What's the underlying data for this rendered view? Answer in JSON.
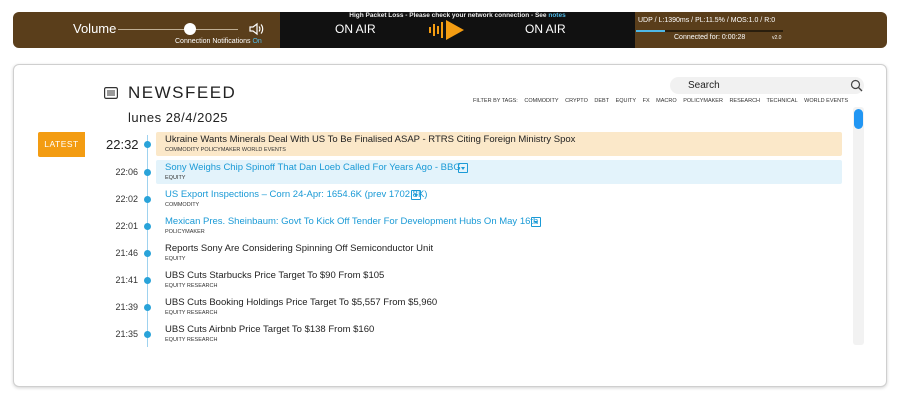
{
  "player": {
    "volume_label": "Volume",
    "volume_level": 0.6,
    "notifications_label": "Connection Notifications",
    "notifications_state": "On",
    "alert_text": "High Packet Loss - Please check your network connection - See",
    "alert_link": "notes",
    "status_left": "ON AIR",
    "status_right": "ON AIR",
    "stats": "UDP / L:1390ms / PL:11.5% / MOS:1.0 / R:0",
    "connected_label": "Connected for:",
    "connected_time": "0:00:28",
    "version": "v2.0",
    "colors": {
      "bar": "#5a3e1b",
      "center": "#111111",
      "accent": "#f39c12",
      "link": "#4fb8e6"
    }
  },
  "newsfeed": {
    "title": "NEWSFEED",
    "date": "lunes 28/4/2025",
    "search_placeholder": "Search",
    "filter_label": "FILTER BY TAGS:",
    "filter_tags": [
      "COMMODITY",
      "CRYPTO",
      "DEBT",
      "EQUITY",
      "FX",
      "MACRO",
      "POLICYMAKER",
      "RESEARCH",
      "TECHNICAL",
      "WORLD EVENTS"
    ],
    "latest_label": "LATEST",
    "items": [
      {
        "time": "22:32",
        "headline": "Ukraine Wants Minerals Deal With US To Be Finalised ASAP - RTRS Citing Foreign Ministry Spox",
        "tags": "COMMODITY  POLICYMAKER  WORLD EVENTS",
        "highlight": "latest",
        "expandable": false
      },
      {
        "time": "22:06",
        "headline": "Sony Weighs Chip Spinoff That Dan Loeb Called For Years Ago - BBG",
        "tags": "EQUITY",
        "highlight": "blue",
        "expandable": true
      },
      {
        "time": "22:02",
        "headline": "US Export Inspections – Corn 24-Apr: 1654.6K (prev 1702.8K)",
        "tags": "COMMODITY",
        "highlight": "none",
        "expandable": true
      },
      {
        "time": "22:01",
        "headline": "Mexican Pres. Sheinbaum: Govt To Kick Off Tender For Development Hubs On May 16th",
        "tags": "POLICYMAKER",
        "highlight": "none",
        "expandable": true
      },
      {
        "time": "21:46",
        "headline": "Reports Sony Are Considering Spinning Off Semiconductor Unit",
        "tags": "EQUITY",
        "highlight": "none",
        "expandable": false
      },
      {
        "time": "21:41",
        "headline": "UBS Cuts Starbucks Price Target To $90 From $105",
        "tags": "EQUITY  RESEARCH",
        "highlight": "none",
        "expandable": false
      },
      {
        "time": "21:39",
        "headline": "UBS Cuts Booking Holdings Price Target To $5,557 From $5,960",
        "tags": "EQUITY  RESEARCH",
        "highlight": "none",
        "expandable": false
      },
      {
        "time": "21:35",
        "headline": "UBS Cuts Airbnb Price Target To $138 From $160",
        "tags": "EQUITY  RESEARCH",
        "highlight": "none",
        "expandable": false
      }
    ]
  }
}
